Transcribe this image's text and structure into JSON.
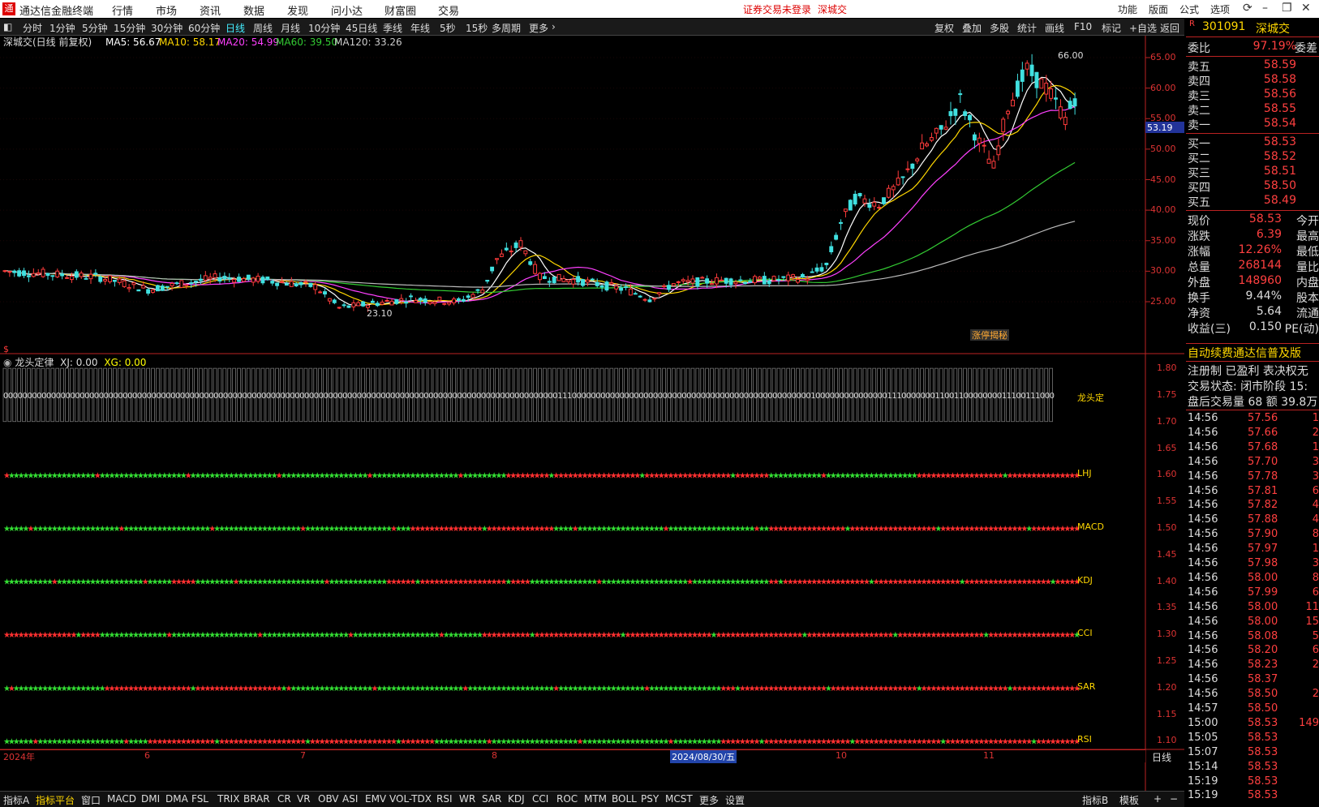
{
  "menu": {
    "app_title": "通达信金融终端",
    "items": [
      "行情",
      "市场",
      "资讯",
      "数据",
      "发现",
      "问小达",
      "财富圈",
      "交易"
    ],
    "login_notice": "证券交易未登录",
    "stock_link": "深城交",
    "right_items": [
      "功能",
      "版面",
      "公式",
      "选项"
    ]
  },
  "periods": {
    "items": [
      "分时",
      "1分钟",
      "5分钟",
      "15分钟",
      "30分钟",
      "60分钟",
      "日线",
      "周线",
      "月线",
      "10分钟",
      "45日线",
      "季线",
      "年线",
      "5秒",
      "15秒",
      "多周期",
      "更多"
    ],
    "active": "日线",
    "right_buttons": [
      "复权",
      "叠加",
      "多股",
      "统计",
      "画线",
      "F10",
      "标记",
      "+自选",
      "返回"
    ]
  },
  "main_chart": {
    "title": "深城交(日线 前复权)",
    "ma_labels": [
      {
        "text": "MA5: 56.67",
        "color": "#ffffff"
      },
      {
        "text": "MA10: 58.17",
        "color": "#ffd700"
      },
      {
        "text": "MA20: 54.99",
        "color": "#ff40ff"
      },
      {
        "text": "MA60: 39.50",
        "color": "#33cc33"
      },
      {
        "text": "MA120: 33.26",
        "color": "#cccccc"
      }
    ],
    "y_ticks": [
      "65.00",
      "60.00",
      "55.00",
      "50.00",
      "45.00",
      "40.00",
      "35.00",
      "30.00",
      "25.00"
    ],
    "current_price_label": "53.19",
    "high_marker": "66.00",
    "low_marker": "23.10",
    "news_tag": "涨停揭秘",
    "colors": {
      "up": "#ff3b3b",
      "down": "#40e0e0",
      "ma5": "#ffffff",
      "ma10": "#ffd700",
      "ma20": "#ff40ff",
      "ma60": "#33cc33",
      "ma120": "#bbbbbb"
    }
  },
  "indicator": {
    "title": "龙头定律",
    "xj": "XJ: 0.00",
    "xg": "XG: 0.00",
    "y_ticks": [
      "1.80",
      "1.75",
      "1.70",
      "1.65",
      "1.60",
      "1.55",
      "1.50",
      "1.45",
      "1.40",
      "1.35",
      "1.30",
      "1.25",
      "1.20",
      "1.15",
      "1.10"
    ],
    "row_labels": [
      "龙头定",
      "LHJ",
      "MACD",
      "KDJ",
      "CCI",
      "SAR",
      "RSI"
    ],
    "binary_digits": "0000000000000000000000000000000000000000000000000000000000000000000000000000000000000000000000000000000000000000000011100000000000000000000000000000000000000000000000000100000000000000011100000001100110000000011100111000"
  },
  "date_axis": {
    "labels": [
      "2024年",
      "6",
      "7",
      "8",
      "2024/08/30/五",
      "10",
      "11"
    ],
    "period_label": "日线"
  },
  "quote_panel": {
    "code": "301091",
    "name": "深城交",
    "weibi_label": "委比",
    "weibi_value": "97.19%",
    "weicha_label": "委差",
    "asks": [
      {
        "label": "卖五",
        "price": "58.59"
      },
      {
        "label": "卖四",
        "price": "58.58"
      },
      {
        "label": "卖三",
        "price": "58.56"
      },
      {
        "label": "卖二",
        "price": "58.55"
      },
      {
        "label": "卖一",
        "price": "58.54"
      }
    ],
    "bids": [
      {
        "label": "买一",
        "price": "58.53"
      },
      {
        "label": "买二",
        "price": "58.52"
      },
      {
        "label": "买三",
        "price": "58.51"
      },
      {
        "label": "买四",
        "price": "58.50"
      },
      {
        "label": "买五",
        "price": "58.49"
      }
    ],
    "stats": [
      {
        "label": "现价",
        "value": "58.53",
        "label2": "今开"
      },
      {
        "label": "涨跌",
        "value": "6.39",
        "label2": "最高"
      },
      {
        "label": "涨幅",
        "value": "12.26%",
        "label2": "最低"
      },
      {
        "label": "总量",
        "value": "268144",
        "label2": "量比"
      },
      {
        "label": "外盘",
        "value": "148960",
        "label2": "内盘"
      },
      {
        "label": "换手",
        "value": "9.44%",
        "label2": "股本"
      },
      {
        "label": "净资",
        "value": "5.64",
        "label2": "流通"
      },
      {
        "label": "收益(三)",
        "value": "0.150",
        "label2": "PE(动)"
      }
    ],
    "promo": "自动续费通达信普及版",
    "info_lines": [
      "注册制 已盈利 表决权无",
      "交易状态: 闭市阶段 15:",
      "盘后交易量 68 额 39.8万"
    ],
    "ticks": [
      {
        "t": "14:56",
        "p": "57.56",
        "v": "1"
      },
      {
        "t": "14:56",
        "p": "57.66",
        "v": "2"
      },
      {
        "t": "14:56",
        "p": "57.68",
        "v": "1"
      },
      {
        "t": "14:56",
        "p": "57.70",
        "v": "3"
      },
      {
        "t": "14:56",
        "p": "57.78",
        "v": "3"
      },
      {
        "t": "14:56",
        "p": "57.81",
        "v": "6"
      },
      {
        "t": "14:56",
        "p": "57.82",
        "v": "4"
      },
      {
        "t": "14:56",
        "p": "57.88",
        "v": "4"
      },
      {
        "t": "14:56",
        "p": "57.90",
        "v": "8"
      },
      {
        "t": "14:56",
        "p": "57.97",
        "v": "1"
      },
      {
        "t": "14:56",
        "p": "57.98",
        "v": "3"
      },
      {
        "t": "14:56",
        "p": "58.00",
        "v": "8"
      },
      {
        "t": "14:56",
        "p": "57.99",
        "v": "6"
      },
      {
        "t": "14:56",
        "p": "58.00",
        "v": "11"
      },
      {
        "t": "14:56",
        "p": "58.00",
        "v": "15"
      },
      {
        "t": "14:56",
        "p": "58.08",
        "v": "5"
      },
      {
        "t": "14:56",
        "p": "58.20",
        "v": "6"
      },
      {
        "t": "14:56",
        "p": "58.23",
        "v": "2"
      },
      {
        "t": "14:56",
        "p": "58.37",
        "v": ""
      },
      {
        "t": "14:56",
        "p": "58.50",
        "v": "2"
      },
      {
        "t": "14:57",
        "p": "58.50",
        "v": ""
      },
      {
        "t": "15:00",
        "p": "58.53",
        "v": "149"
      },
      {
        "t": "15:05",
        "p": "58.53",
        "v": ""
      },
      {
        "t": "15:07",
        "p": "58.53",
        "v": ""
      },
      {
        "t": "15:14",
        "p": "58.53",
        "v": ""
      },
      {
        "t": "15:19",
        "p": "58.53",
        "v": ""
      },
      {
        "t": "15:19",
        "p": "58.53",
        "v": ""
      }
    ]
  },
  "bottom_tabs": {
    "items": [
      "指标A",
      "指标平台",
      "窗口",
      "MACD",
      "DMI",
      "DMA",
      "FSL",
      "TRIX",
      "BRAR",
      "CR",
      "VR",
      "OBV",
      "ASI",
      "EMV",
      "VOL-TDX",
      "RSI",
      "WR",
      "SAR",
      "KDJ",
      "CCI",
      "ROC",
      "MTM",
      "BOLL",
      "PSY",
      "MCST",
      "更多",
      "设置"
    ],
    "active": "指标平台",
    "right_items": [
      "指标B",
      "模板",
      "+",
      "−"
    ]
  }
}
